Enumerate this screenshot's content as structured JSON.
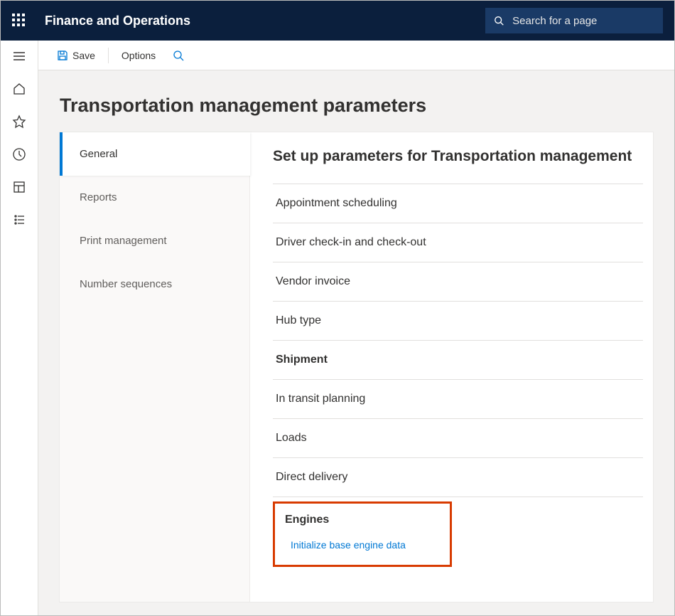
{
  "app_title": "Finance and Operations",
  "search": {
    "placeholder": "Search for a page"
  },
  "actionbar": {
    "save_label": "Save",
    "options_label": "Options"
  },
  "page": {
    "title": "Transportation management parameters",
    "tabs": {
      "general": "General",
      "reports": "Reports",
      "print_management": "Print management",
      "number_sequences": "Number sequences"
    },
    "detail_title": "Set up parameters for Transportation management",
    "sections": {
      "appointment_scheduling": "Appointment scheduling",
      "driver_check": "Driver check-in and check-out",
      "vendor_invoice": "Vendor invoice",
      "hub_type": "Hub type",
      "shipment": "Shipment",
      "in_transit_planning": "In transit planning",
      "loads": "Loads",
      "direct_delivery": "Direct delivery",
      "engines": "Engines",
      "initialize_link": "Initialize base engine data"
    }
  }
}
